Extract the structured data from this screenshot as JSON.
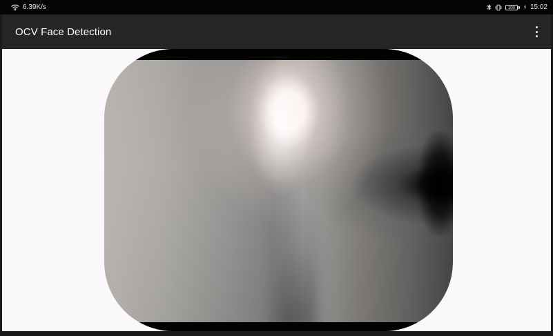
{
  "status_bar": {
    "network_speed": "6.39K/s",
    "icons": {
      "wifi": "wifi-icon",
      "bluetooth": "bluetooth-icon",
      "vibrate": "vibrate-icon",
      "battery": "battery-icon"
    },
    "battery_level": "100",
    "time": "15:02"
  },
  "app_bar": {
    "title": "OCV Face Detection",
    "menu_icon": "more-vertical-icon"
  },
  "colors": {
    "status_bar_bg": "#050506",
    "app_bar_bg": "#252525",
    "content_bg": "#fbf8fc",
    "frame_bg": "#1b1b1d"
  }
}
